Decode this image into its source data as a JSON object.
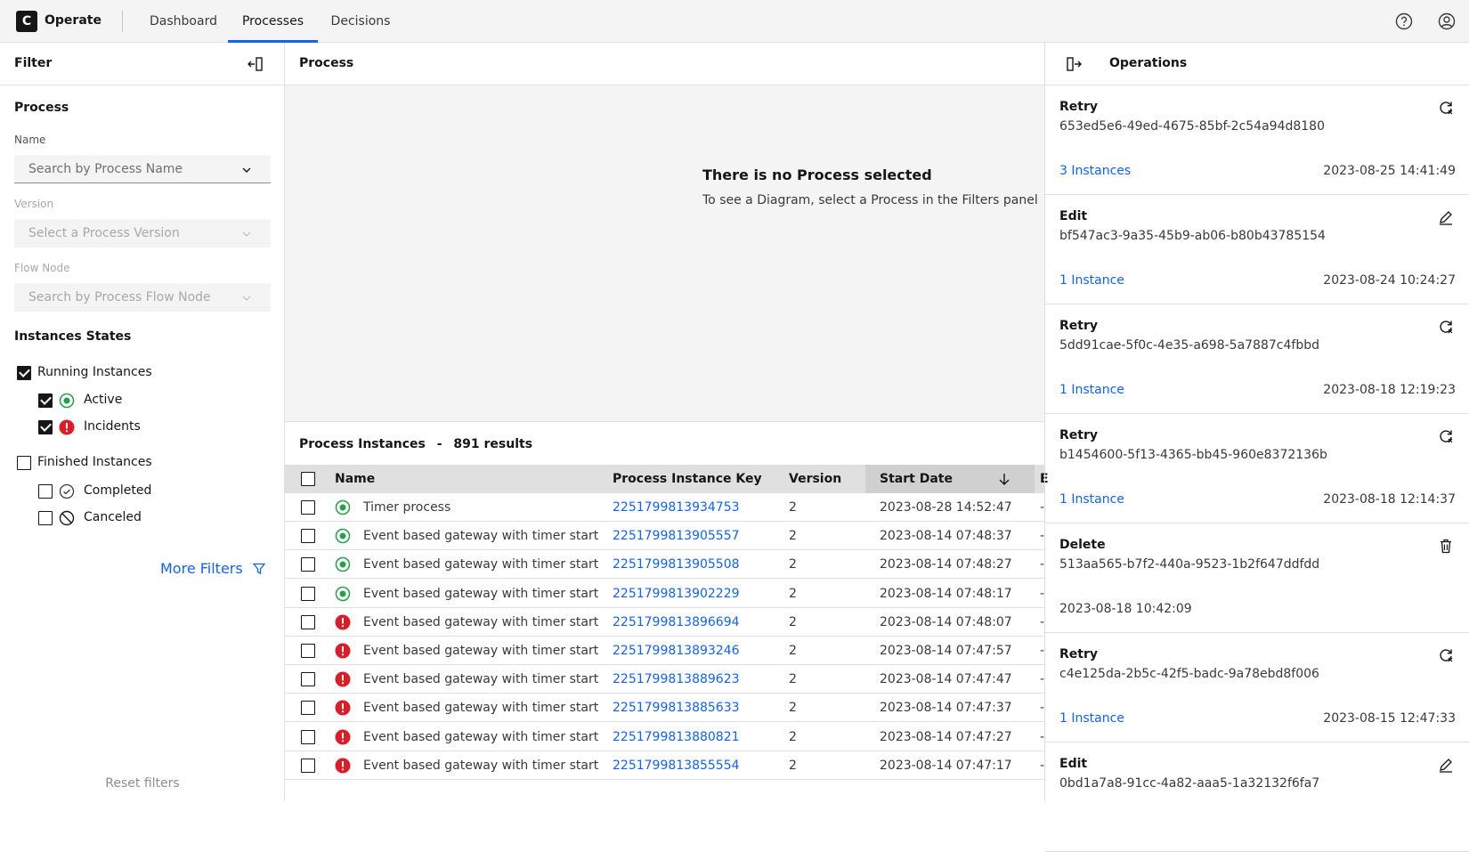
{
  "header": {
    "logo_letter": "C",
    "brand": "Operate",
    "nav": [
      {
        "label": "Dashboard",
        "active": false
      },
      {
        "label": "Processes",
        "active": true
      },
      {
        "label": "Decisions",
        "active": false
      }
    ],
    "icons": [
      "help-icon",
      "user-icon"
    ]
  },
  "filter": {
    "title": "Filter",
    "process_section": "Process",
    "name_label": "Name",
    "name_placeholder": "Search by Process Name",
    "version_label": "Version",
    "version_placeholder": "Select a Process Version",
    "flow_node_label": "Flow Node",
    "flow_node_placeholder": "Search by Process Flow Node",
    "states_section": "Instances States",
    "running": {
      "label": "Running Instances",
      "checked": true
    },
    "active": {
      "label": "Active",
      "checked": true
    },
    "incidents": {
      "label": "Incidents",
      "checked": true
    },
    "finished": {
      "label": "Finished Instances",
      "checked": false
    },
    "completed": {
      "label": "Completed",
      "checked": false
    },
    "canceled": {
      "label": "Canceled",
      "checked": false
    },
    "more_filters": "More Filters",
    "reset": "Reset filters"
  },
  "process": {
    "title": "Process",
    "empty_title": "There is no Process selected",
    "empty_sub": "To see a Diagram, select a Process in the Filters panel"
  },
  "instances": {
    "title": "Process Instances",
    "separator": "-",
    "count": "891 results",
    "columns": {
      "name": "Name",
      "key": "Process Instance Key",
      "version": "Version",
      "start": "Start Date",
      "end": "E"
    },
    "rows": [
      {
        "state": "active",
        "name": "Timer process",
        "key": "2251799813934753",
        "version": "2",
        "date": "2023-08-28 14:52:47",
        "end": "-"
      },
      {
        "state": "active",
        "name": "Event based gateway with timer start",
        "key": "2251799813905557",
        "version": "2",
        "date": "2023-08-14 07:48:37",
        "end": "-"
      },
      {
        "state": "active",
        "name": "Event based gateway with timer start",
        "key": "2251799813905508",
        "version": "2",
        "date": "2023-08-14 07:48:27",
        "end": "-"
      },
      {
        "state": "active",
        "name": "Event based gateway with timer start",
        "key": "2251799813902229",
        "version": "2",
        "date": "2023-08-14 07:48:17",
        "end": "-"
      },
      {
        "state": "incident",
        "name": "Event based gateway with timer start",
        "key": "2251799813896694",
        "version": "2",
        "date": "2023-08-14 07:48:07",
        "end": "-"
      },
      {
        "state": "incident",
        "name": "Event based gateway with timer start",
        "key": "2251799813893246",
        "version": "2",
        "date": "2023-08-14 07:47:57",
        "end": "-"
      },
      {
        "state": "incident",
        "name": "Event based gateway with timer start",
        "key": "2251799813889623",
        "version": "2",
        "date": "2023-08-14 07:47:47",
        "end": "-"
      },
      {
        "state": "incident",
        "name": "Event based gateway with timer start",
        "key": "2251799813885633",
        "version": "2",
        "date": "2023-08-14 07:47:37",
        "end": "-"
      },
      {
        "state": "incident",
        "name": "Event based gateway with timer start",
        "key": "2251799813880821",
        "version": "2",
        "date": "2023-08-14 07:47:27",
        "end": "-"
      },
      {
        "state": "incident",
        "name": "Event based gateway with timer start",
        "key": "2251799813855554",
        "version": "2",
        "date": "2023-08-14 07:47:17",
        "end": "-"
      }
    ]
  },
  "operations": {
    "title": "Operations",
    "items": [
      {
        "type": "Retry",
        "id": "653ed5e6-49ed-4675-85bf-2c54a94d8180",
        "link": "3 Instances",
        "date": "2023-08-25 14:41:49",
        "icon": "retry-icon"
      },
      {
        "type": "Edit",
        "id": "bf547ac3-9a35-45b9-ab06-b80b43785154",
        "link": "1 Instance",
        "date": "2023-08-24 10:24:27",
        "icon": "edit-icon"
      },
      {
        "type": "Retry",
        "id": "5dd91cae-5f0c-4e35-a698-5a7887c4fbbd",
        "link": "1 Instance",
        "date": "2023-08-18 12:19:23",
        "icon": "retry-icon"
      },
      {
        "type": "Retry",
        "id": "b1454600-5f13-4365-bb45-960e8372136b",
        "link": "1 Instance",
        "date": "2023-08-18 12:14:37",
        "icon": "retry-icon"
      },
      {
        "type": "Delete",
        "id": "513aa565-b7f2-440a-9523-1b2f647ddfdd",
        "link": "",
        "date": "2023-08-18 10:42:09",
        "icon": "delete-icon"
      },
      {
        "type": "Retry",
        "id": "c4e125da-2b5c-42f5-badc-9a78ebd8f006",
        "link": "1 Instance",
        "date": "2023-08-15 12:47:33",
        "icon": "retry-icon"
      },
      {
        "type": "Edit",
        "id": "0bd1a7a8-91cc-4a82-aaa5-1a32132f6fa7",
        "link": "",
        "date": "",
        "icon": "edit-icon"
      }
    ]
  },
  "colors": {
    "accent": "#0f62fe",
    "active": "#24a148",
    "incident": "#da1e28"
  }
}
